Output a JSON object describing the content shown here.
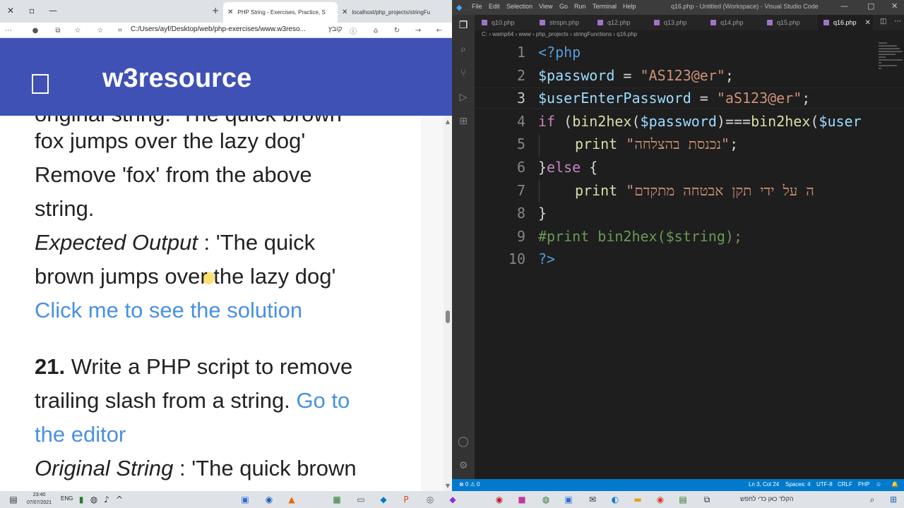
{
  "browser": {
    "tabs": [
      {
        "label": "PHP String - Exercises, Practice, S",
        "active": true
      },
      {
        "label": "localhost/php_projects/stringFu",
        "active": false
      }
    ],
    "new_tab_glyph": "+",
    "address": "C:/Users/ayf/Desktop/web/php-exercises/www.w3reso...",
    "address_rtl": "קובץ",
    "site_title": "w3resource",
    "content": {
      "cut_line": "original string: 'The quick brown",
      "line1": "fox jumps over the lazy dog'",
      "line2": "Remove 'fox' from the above",
      "line3": "string.",
      "expected_label": "Expected Output",
      "expected_sep": " : ",
      "expected_value1": "'The quick",
      "line5": "brown jumps over the lazy dog'",
      "solution_link": "Click me to see the solution",
      "q_number": "21.",
      "q_text": " Write a PHP script to remove",
      "q_text2": "trailing slash from a string.",
      "editor_link1": "Go to",
      "editor_link2": "the editor",
      "orig_label": "Original String",
      "orig_sep": " : ",
      "orig_value": "'The quick brown"
    }
  },
  "vscode": {
    "menu": [
      "File",
      "Edit",
      "Selection",
      "View",
      "Go",
      "Run",
      "Terminal",
      "Help"
    ],
    "window_title": "q16.php - Untitled (Workspace) - Visual Studio Code",
    "tabs": [
      {
        "label": "q10.php",
        "active": false
      },
      {
        "label": "strspn.php",
        "active": false
      },
      {
        "label": "q12.php",
        "active": false
      },
      {
        "label": "q13.php",
        "active": false
      },
      {
        "label": "q14.php",
        "active": false
      },
      {
        "label": "q15.php",
        "active": false
      },
      {
        "label": "q16.php",
        "active": true
      }
    ],
    "breadcrumbs": "C: › wamp64 › www › php_projects › stringFunctions › q16.php",
    "line_numbers": [
      "1",
      "2",
      "3",
      "4",
      "5",
      "6",
      "7",
      "8",
      "9",
      "10"
    ],
    "code": {
      "l1_open": "<?",
      "l1_php": "php",
      "l2_var": "$password",
      "l2_eq": " = ",
      "l2_str": "\"AS123@er\"",
      "l2_end": ";",
      "l3_var": "$userEnterPassword",
      "l3_eq": " = ",
      "l3_str": "\"aS123@er\"",
      "l3_end": ";",
      "l4_if": "if",
      "l4_a": " (",
      "l4_fn1": "bin2hex",
      "l4_b": "(",
      "l4_var1": "$password",
      "l4_c": ")===",
      "l4_fn2": "bin2hex",
      "l4_d": "(",
      "l4_var2": "$user",
      "l5_print": "print",
      "l5_str": "\"נכנסת בהצלחה\"",
      "l5_end": ";",
      "l6_close": "}",
      "l6_else": "else",
      "l6_open": " {",
      "l7_print": "print",
      "l7_str": "\"ה על ידי תקן אבטחה מתקדם",
      "l8": "}",
      "l9": "#print bin2hex($string);",
      "l10_q": "?",
      "l10_gt": ">"
    },
    "status": {
      "errors": "⊗ 0 ⚠ 0",
      "position": "Ln 3, Col 24",
      "spaces": "Spaces: 4",
      "encoding": "UTF-8",
      "eol": "CRLF",
      "language": "PHP"
    }
  },
  "taskbar": {
    "time": "23:40",
    "date": "07/07/2021",
    "lang": "ENG",
    "search": "הקלד כאן כדי לחפש"
  },
  "colors": {
    "site_header": "#3f51b5",
    "link": "#4a90e2",
    "status_bar": "#007acc"
  }
}
